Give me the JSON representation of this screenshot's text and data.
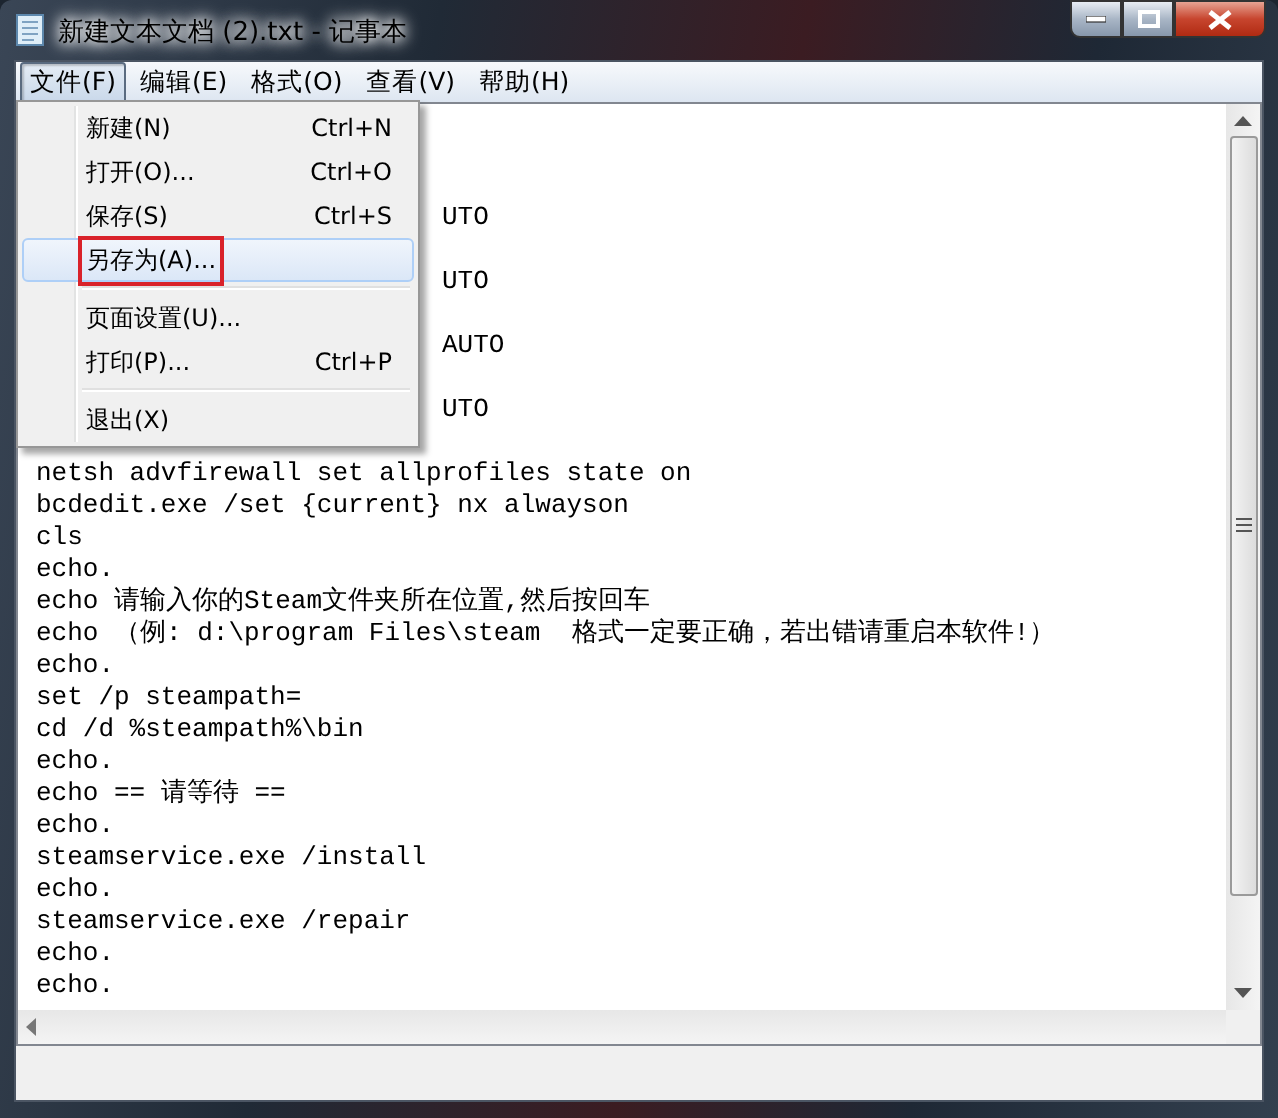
{
  "window": {
    "title": "新建文本文档 (2).txt - 记事本"
  },
  "menu_bar": [
    {
      "label": "文件(F)",
      "selected": true
    },
    {
      "label": "编辑(E)",
      "selected": false
    },
    {
      "label": "格式(O)",
      "selected": false
    },
    {
      "label": "查看(V)",
      "selected": false
    },
    {
      "label": "帮助(H)",
      "selected": false
    }
  ],
  "file_menu": {
    "items": [
      {
        "kind": "item",
        "label": "新建(N)",
        "shortcut": "Ctrl+N",
        "selected": false,
        "outlined": false
      },
      {
        "kind": "item",
        "label": "打开(O)...",
        "shortcut": "Ctrl+O",
        "selected": false,
        "outlined": false
      },
      {
        "kind": "item",
        "label": "保存(S)",
        "shortcut": "Ctrl+S",
        "selected": false,
        "outlined": false
      },
      {
        "kind": "item",
        "label": "另存为(A)...",
        "selected": true,
        "outlined": true
      },
      {
        "kind": "separator"
      },
      {
        "kind": "item",
        "label": "页面设置(U)...",
        "selected": false,
        "outlined": false
      },
      {
        "kind": "item",
        "label": "打印(P)...",
        "shortcut": "Ctrl+P",
        "selected": false,
        "outlined": false
      },
      {
        "kind": "separator"
      },
      {
        "kind": "item",
        "label": "退出(X)",
        "selected": false,
        "outlined": false
      }
    ]
  },
  "editor": {
    "lines": [
      {
        "kind": "covered"
      },
      {
        "kind": "covered"
      },
      {
        "kind": "covered"
      },
      {
        "kind": "partial",
        "text": "UTO"
      },
      {
        "kind": "covered"
      },
      {
        "kind": "partial",
        "text": "UTO"
      },
      {
        "kind": "covered"
      },
      {
        "kind": "partial",
        "text": "AUTO"
      },
      {
        "kind": "covered"
      },
      {
        "kind": "partial",
        "text": "UTO"
      },
      {
        "kind": "covered"
      },
      {
        "kind": "text",
        "text": "netsh advfirewall set allprofiles state on"
      },
      {
        "kind": "text",
        "text": "bcdedit.exe /set {current} nx alwayson"
      },
      {
        "kind": "text",
        "text": "cls"
      },
      {
        "kind": "text",
        "text": "echo."
      },
      {
        "kind": "text",
        "text": "echo 请输入你的Steam文件夹所在位置,然后按回车"
      },
      {
        "kind": "text",
        "text": "echo （例: d:\\program Files\\steam  格式一定要正确，若出错请重启本软件!）"
      },
      {
        "kind": "text",
        "text": "echo."
      },
      {
        "kind": "text",
        "text": "set /p steampath="
      },
      {
        "kind": "text",
        "text": "cd /d %steampath%\\bin"
      },
      {
        "kind": "text",
        "text": "echo."
      },
      {
        "kind": "text",
        "text": "echo == 请等待 =="
      },
      {
        "kind": "text",
        "text": "echo."
      },
      {
        "kind": "text",
        "text": "steamservice.exe /install"
      },
      {
        "kind": "text",
        "text": "echo."
      },
      {
        "kind": "text",
        "text": "steamservice.exe /repair"
      },
      {
        "kind": "text",
        "text": "echo."
      },
      {
        "kind": "text",
        "text": "echo."
      }
    ]
  }
}
